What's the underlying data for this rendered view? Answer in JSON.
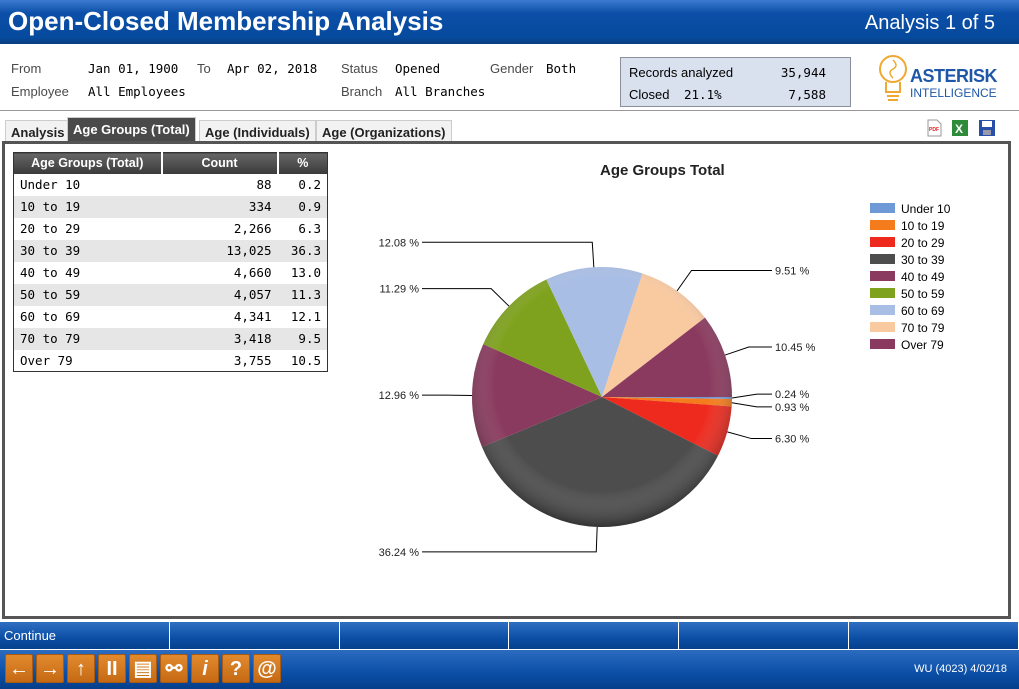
{
  "header": {
    "title": "Open-Closed Membership Analysis",
    "position": "Analysis 1 of 5"
  },
  "filters": {
    "from_label": "From",
    "from": "Jan 01, 1900",
    "to_label": "To",
    "to": "Apr 02, 2018",
    "status_label": "Status",
    "status": "Opened",
    "gender_label": "Gender",
    "gender": "Both",
    "employee_label": "Employee",
    "employee": "All Employees",
    "branch_label": "Branch",
    "branch": "All Branches"
  },
  "records": {
    "analyzed_label": "Records analyzed",
    "analyzed": "35,944",
    "closed_label": "Closed",
    "closed_pct": "21.1%",
    "closed": "7,588"
  },
  "logo": {
    "line1": "ASTERISK",
    "line2": "INTELLIGENCE"
  },
  "tabs": [
    {
      "label": "Analysis"
    },
    {
      "label": "Age Groups (Total)",
      "active": true
    },
    {
      "label": "Age (Individuals)"
    },
    {
      "label": "Age (Organizations)"
    }
  ],
  "export_icons": [
    "pdf-icon",
    "excel-icon",
    "save-icon"
  ],
  "table": {
    "headers": [
      "Age Groups (Total)",
      "Count",
      "%"
    ],
    "rows": [
      [
        "Under 10",
        "88",
        "0.2"
      ],
      [
        "10 to 19",
        "334",
        "0.9"
      ],
      [
        "20 to 29",
        "2,266",
        "6.3"
      ],
      [
        "30 to 39",
        "13,025",
        "36.3"
      ],
      [
        "40 to 49",
        "4,660",
        "13.0"
      ],
      [
        "50 to 59",
        "4,057",
        "11.3"
      ],
      [
        "60 to 69",
        "4,341",
        "12.1"
      ],
      [
        "70 to 79",
        "3,418",
        "9.5"
      ],
      [
        "Over 79",
        "3,755",
        "10.5"
      ]
    ]
  },
  "chart_data": {
    "type": "pie",
    "title": "Age Groups Total",
    "legend_position": "right",
    "categories": [
      "Under 10",
      "10 to 19",
      "20 to 29",
      "30 to 39",
      "40 to 49",
      "50 to 59",
      "60 to 69",
      "70 to 79",
      "Over 79"
    ],
    "values": [
      0.24,
      0.93,
      6.3,
      36.24,
      12.96,
      11.29,
      12.08,
      9.51,
      10.45
    ],
    "labels": [
      "0.24 %",
      "0.93 %",
      "6.30 %",
      "36.24 %",
      "12.96 %",
      "11.29 %",
      "12.08 %",
      "9.51 %",
      "10.45 %"
    ],
    "colors": [
      "#6f98d6",
      "#f47c1c",
      "#ee2a1e",
      "#4d4d4d",
      "#8a3a5e",
      "#7fa21e",
      "#a9bee4",
      "#f9c9a0",
      "#8a3a5e"
    ]
  },
  "bottom_bar": {
    "buttons": [
      "Continue",
      "",
      "",
      "",
      "",
      ""
    ]
  },
  "toolbar": {
    "buttons": [
      {
        "icon": "back-arrow-icon",
        "glyph": "←"
      },
      {
        "icon": "forward-arrow-icon",
        "glyph": "→"
      },
      {
        "icon": "up-arrow-icon",
        "glyph": "↑"
      },
      {
        "icon": "pause-icon",
        "glyph": "II"
      },
      {
        "icon": "print-icon",
        "glyph": "▤"
      },
      {
        "icon": "link-icon",
        "glyph": "⚯"
      },
      {
        "icon": "info-icon",
        "glyph": "i"
      },
      {
        "icon": "help-icon",
        "glyph": "?"
      },
      {
        "icon": "email-icon",
        "glyph": "@"
      }
    ],
    "status": "WU (4023) 4/02/18"
  }
}
